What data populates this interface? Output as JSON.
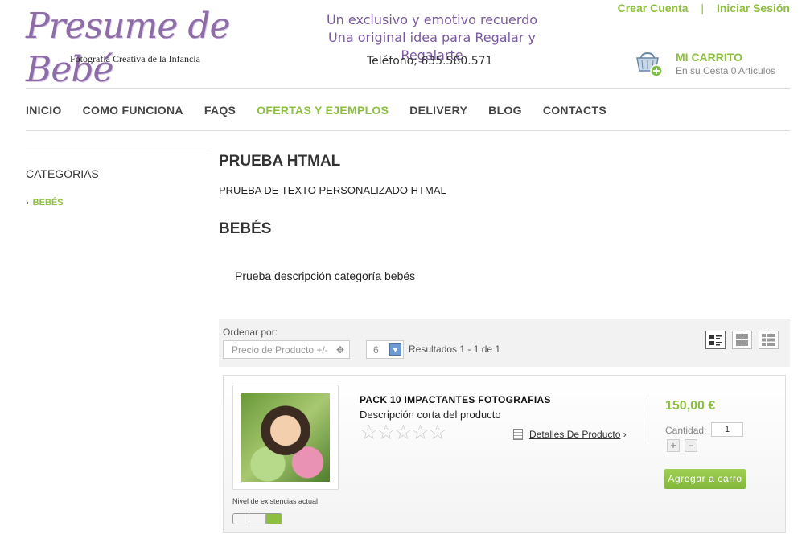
{
  "header": {
    "logo_script": "Presume de Bebé",
    "logo_sub": "Fotografía Creativa de la Infancia",
    "slogan_line1": "Un exclusivo y emotivo recuerdo",
    "slogan_line2": "Una original idea para Regalar y Regalarte",
    "phone": "Teléfono; 635.580.571"
  },
  "toplinks": {
    "create_account": "Crear Cuenta",
    "separator": "|",
    "login": "Iniciar Sesión"
  },
  "cart": {
    "title": "MI CARRITO",
    "info": "En su Cesta 0 Articulos",
    "icon": "basket-add-icon"
  },
  "nav": {
    "items": [
      {
        "label": "INICIO",
        "active": false
      },
      {
        "label": "COMO FUNCIONA",
        "active": false
      },
      {
        "label": "FAQS",
        "active": false
      },
      {
        "label": "OFERTAS Y EJEMPLOS",
        "active": true
      },
      {
        "label": "DELIVERY",
        "active": false
      },
      {
        "label": "BLOG",
        "active": false
      },
      {
        "label": "CONTACTS",
        "active": false
      }
    ]
  },
  "sidebar": {
    "heading": "CATEGORIAS",
    "arrow": "›",
    "category": "BEBÉS"
  },
  "main": {
    "promo_title": "PRUEBA HTMAL",
    "promo_text": "PRUEBA DE TEXTO PERSONALIZADO HTMAL",
    "category_title": "BEBÉS",
    "category_desc": "Prueba descripción categoría bebés"
  },
  "sortbar": {
    "order_label": "Ordenar por:",
    "order_value": "Precio de Producto +/-",
    "per_page": "6",
    "results": "Resultados 1 - 1 de 1",
    "views": [
      "list-view-icon",
      "grid-view-icon",
      "small-grid-view-icon"
    ]
  },
  "product": {
    "name": "PACK 10 IMPACTANTES FOTOGRAFIAS",
    "short_desc": "Descripción corta del producto",
    "stars": "☆☆☆☆☆",
    "details_link": "Detalles De Producto",
    "details_arrow": "›",
    "price": "150,00 €",
    "qty_label": "Cantidad:",
    "qty_value": "1",
    "plus": "+",
    "minus": "−",
    "add_button": "Agregar a carro",
    "stock_label": "Nivel de existencias actual",
    "stock_level_fraction": 0.33
  },
  "colors": {
    "accent": "#8cbf3f",
    "brand_purple": "#7a5a9e"
  }
}
